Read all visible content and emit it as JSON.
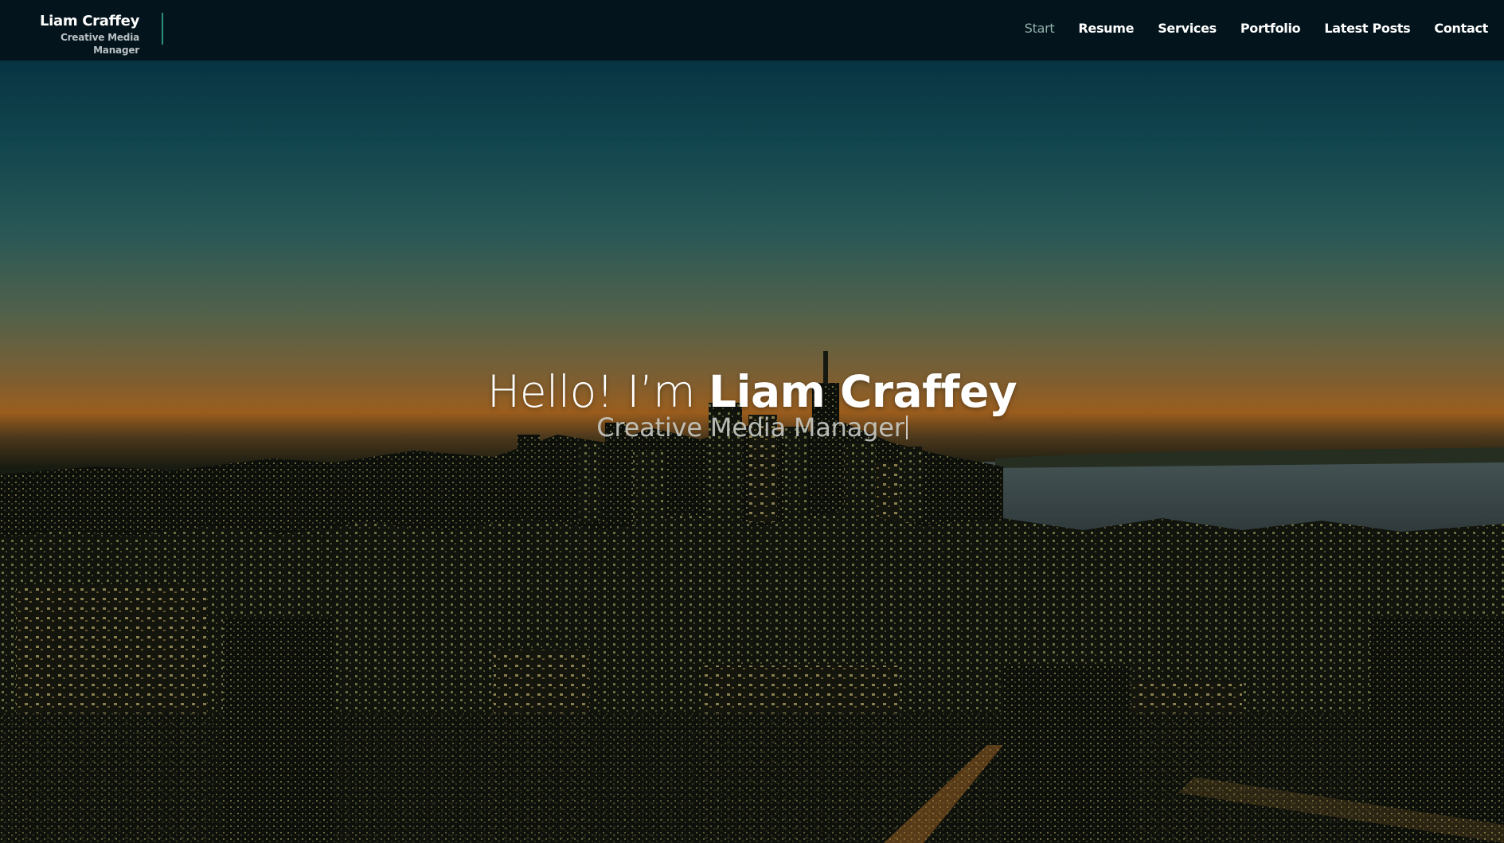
{
  "brand": {
    "name": "Liam Craffey",
    "tagline": "Creative Media Manager"
  },
  "nav": {
    "items": [
      {
        "label": "Start",
        "active": true
      },
      {
        "label": "Resume",
        "active": false
      },
      {
        "label": "Services",
        "active": false
      },
      {
        "label": "Portfolio",
        "active": false
      },
      {
        "label": "Latest Posts",
        "active": false
      },
      {
        "label": "Contact",
        "active": false
      }
    ]
  },
  "hero": {
    "greeting": "Hello! I’m",
    "name": "Liam Craffey",
    "subtitle": "Creative Media Manager",
    "background": "city-skyline-at-dusk"
  },
  "colors": {
    "navbar_bg": "#04141c",
    "accent": "#2f8f7c",
    "active_nav": "#8fb0aa"
  }
}
